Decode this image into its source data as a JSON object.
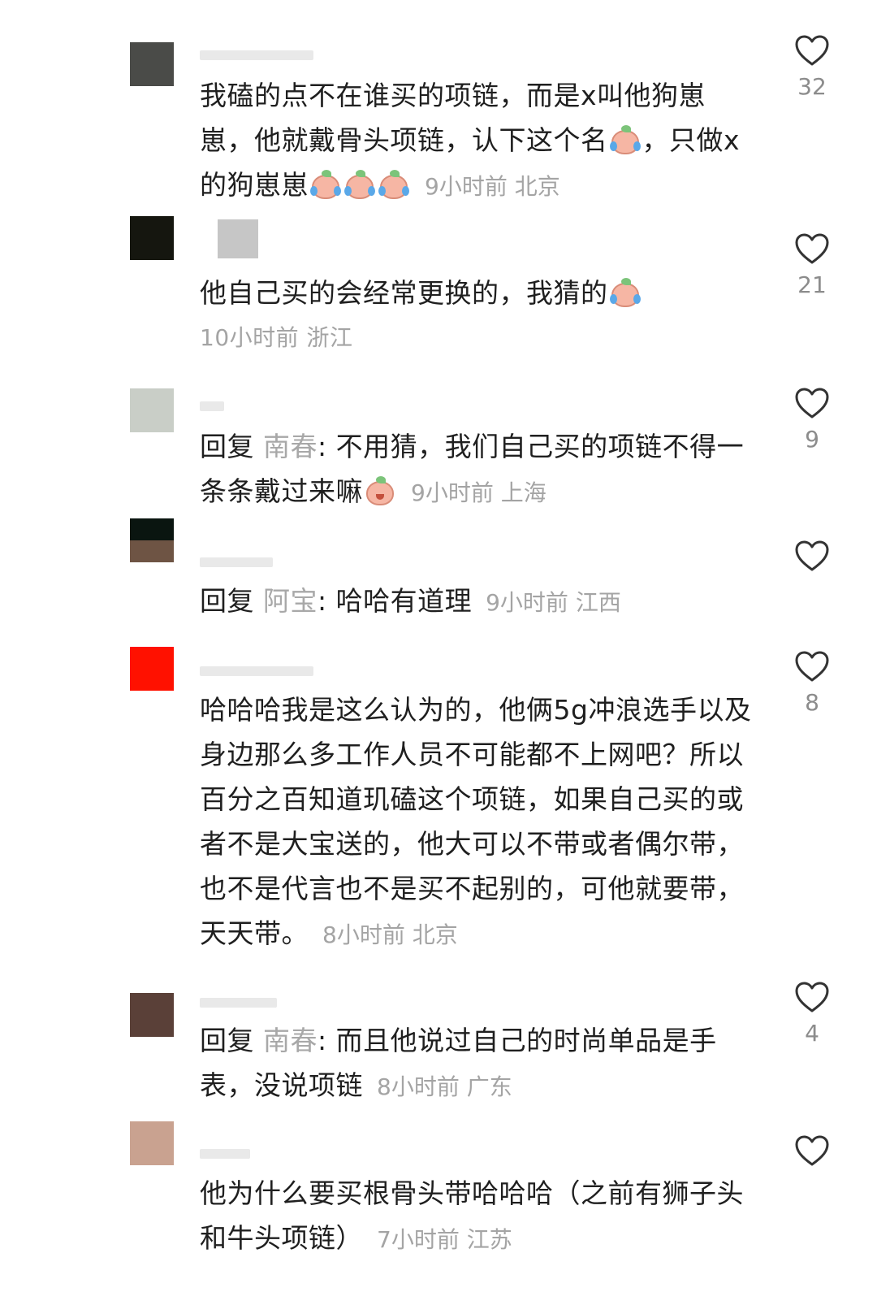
{
  "comments": [
    {
      "avatar_colors": [
        "#4a4b48",
        "#4a4b48"
      ],
      "segments": [
        {
          "t": "我磕的点不在谁买的项链，而是x叫他狗崽崽，他就戴骨头项链，认下这个名"
        },
        {
          "e": "cry"
        },
        {
          "t": "，只做x的狗崽崽"
        },
        {
          "e": "cry"
        },
        {
          "e": "cry"
        },
        {
          "e": "cry"
        }
      ],
      "meta": "9小时前 北京",
      "likes": "32"
    },
    {
      "avatar_colors": [
        "#15160f",
        "#15160f"
      ],
      "segments": [
        {
          "t": "他自己买的会经常更换的，我猜的"
        },
        {
          "e": "cry"
        }
      ],
      "meta": "10小时前 浙江",
      "likes": "21"
    },
    {
      "avatar_colors": [
        "#c9cec7",
        "#c9cec7"
      ],
      "reply_prefix": "回复",
      "reply_to": "南春",
      "segments": [
        {
          "t": ": 不用猜，我们自己买的项链不得一条条戴过来嘛"
        },
        {
          "e": "shy"
        }
      ],
      "meta": "9小时前 上海",
      "likes": "9"
    },
    {
      "avatar_colors": [
        "#0a1510",
        "#6e5444"
      ],
      "reply_prefix": "回复",
      "reply_to": "阿宝",
      "segments": [
        {
          "t": ": 哈哈有道理"
        }
      ],
      "meta": "9小时前 江西",
      "likes": ""
    },
    {
      "avatar_colors": [
        "#ff1100",
        "#ff1100"
      ],
      "segments": [
        {
          "t": "哈哈哈我是这么认为的，他俩5g冲浪选手以及身边那么多工作人员不可能都不上网吧？所以百分之百知道玑磕这个项链，如果自己买的或者不是大宝送的，他大可以不带或者偶尔带，也不是代言也不是买不起别的，可他就要带，天天带。"
        }
      ],
      "meta": "8小时前 北京",
      "likes": "8"
    },
    {
      "avatar_colors": [
        "#5a4038",
        "#5a4038"
      ],
      "reply_prefix": "回复",
      "reply_to": "南春",
      "segments": [
        {
          "t": ": 而且他说过自己的时尚单品是手表，没说项链"
        }
      ],
      "meta": "8小时前 广东",
      "likes": "4"
    },
    {
      "avatar_colors": [
        "#c9a290",
        "#c9a290"
      ],
      "segments": [
        {
          "t": "他为什么要买根骨头带哈哈哈（之前有狮子头和牛头项链）"
        }
      ],
      "meta": "7小时前 江苏",
      "likes": ""
    }
  ]
}
